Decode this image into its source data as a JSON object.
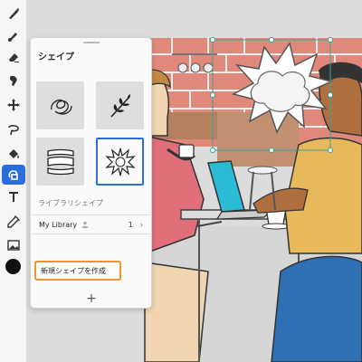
{
  "toolbar": {
    "tools": [
      {
        "name": "brush-tool-icon",
        "active": false
      },
      {
        "name": "pixel-brush-tool-icon",
        "active": false
      },
      {
        "name": "eraser-tool-icon",
        "active": false
      },
      {
        "name": "smudge-tool-icon",
        "active": false
      },
      {
        "name": "move-transform-tool-icon",
        "active": false
      },
      {
        "name": "selection-lasso-tool-icon",
        "active": false
      },
      {
        "name": "fill-tool-icon",
        "active": false
      },
      {
        "name": "shapes-tool-icon",
        "active": true
      },
      {
        "name": "text-tool-icon",
        "active": false
      },
      {
        "name": "eyedropper-tool-icon",
        "active": false
      },
      {
        "name": "image-tool-icon",
        "active": false
      }
    ],
    "current_color": "#111111",
    "accent": "#2b6cdf"
  },
  "panel": {
    "title": "シェイプ",
    "shapes": [
      {
        "name": "scribble-shape"
      },
      {
        "name": "leaf-branch-shape"
      },
      {
        "name": "banner-shape"
      },
      {
        "name": "burst-explosion-shape",
        "selected": true
      }
    ],
    "library_section_label": "ライブラリシェイプ",
    "library": {
      "name": "My Library",
      "count": "1",
      "chevron": "›"
    },
    "create_button_label": "新規シェイプを作成",
    "add_label": "+"
  }
}
